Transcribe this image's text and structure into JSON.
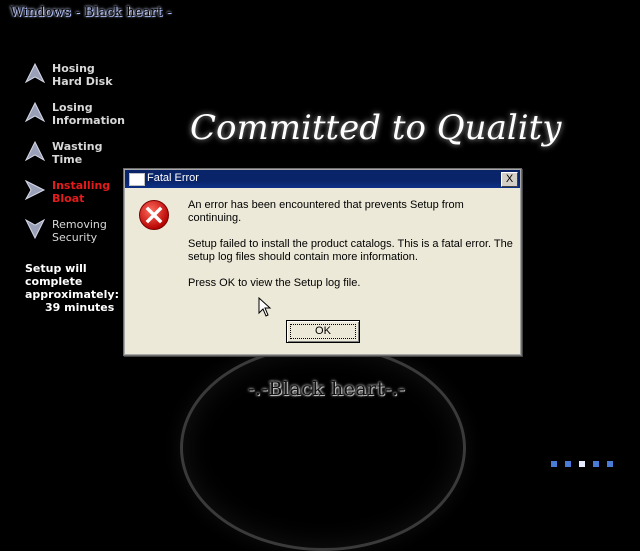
{
  "window_title": "Windows - Black heart -",
  "steps": [
    {
      "label_line1": "Hosing",
      "label_line2": "Hard Disk",
      "state": "done"
    },
    {
      "label_line1": "Losing",
      "label_line2": "Information",
      "state": "done"
    },
    {
      "label_line1": "Wasting",
      "label_line2": "Time",
      "state": "done"
    },
    {
      "label_line1": "Installing",
      "label_line2": "Bloat",
      "state": "active"
    },
    {
      "label_line1": "Removing",
      "label_line2": "Security",
      "state": "pending"
    }
  ],
  "setup_time": {
    "line1": "Setup will complete",
    "line2": "approximately:",
    "line3": "39 minutes"
  },
  "banner": "Committed to Quality",
  "brand": "-.-Black heart-.-",
  "dialog": {
    "title": "Fatal Error",
    "close_label": "X",
    "icon": "error-icon",
    "message1": "An error has been encountered that prevents Setup from continuing.",
    "message2": "Setup failed to install the product catalogs. This is a fatal error. The setup log files should contain more information.",
    "message3": "Press OK to view the Setup log file.",
    "ok_label": "OK"
  },
  "colors": {
    "active_step": "#e51b1b",
    "titlebar": "#0a246a",
    "dialog_bg": "#ece9d8",
    "progress_dot": "#4a7bd6"
  },
  "progress_dots": {
    "total": 5,
    "active_index": 2
  }
}
